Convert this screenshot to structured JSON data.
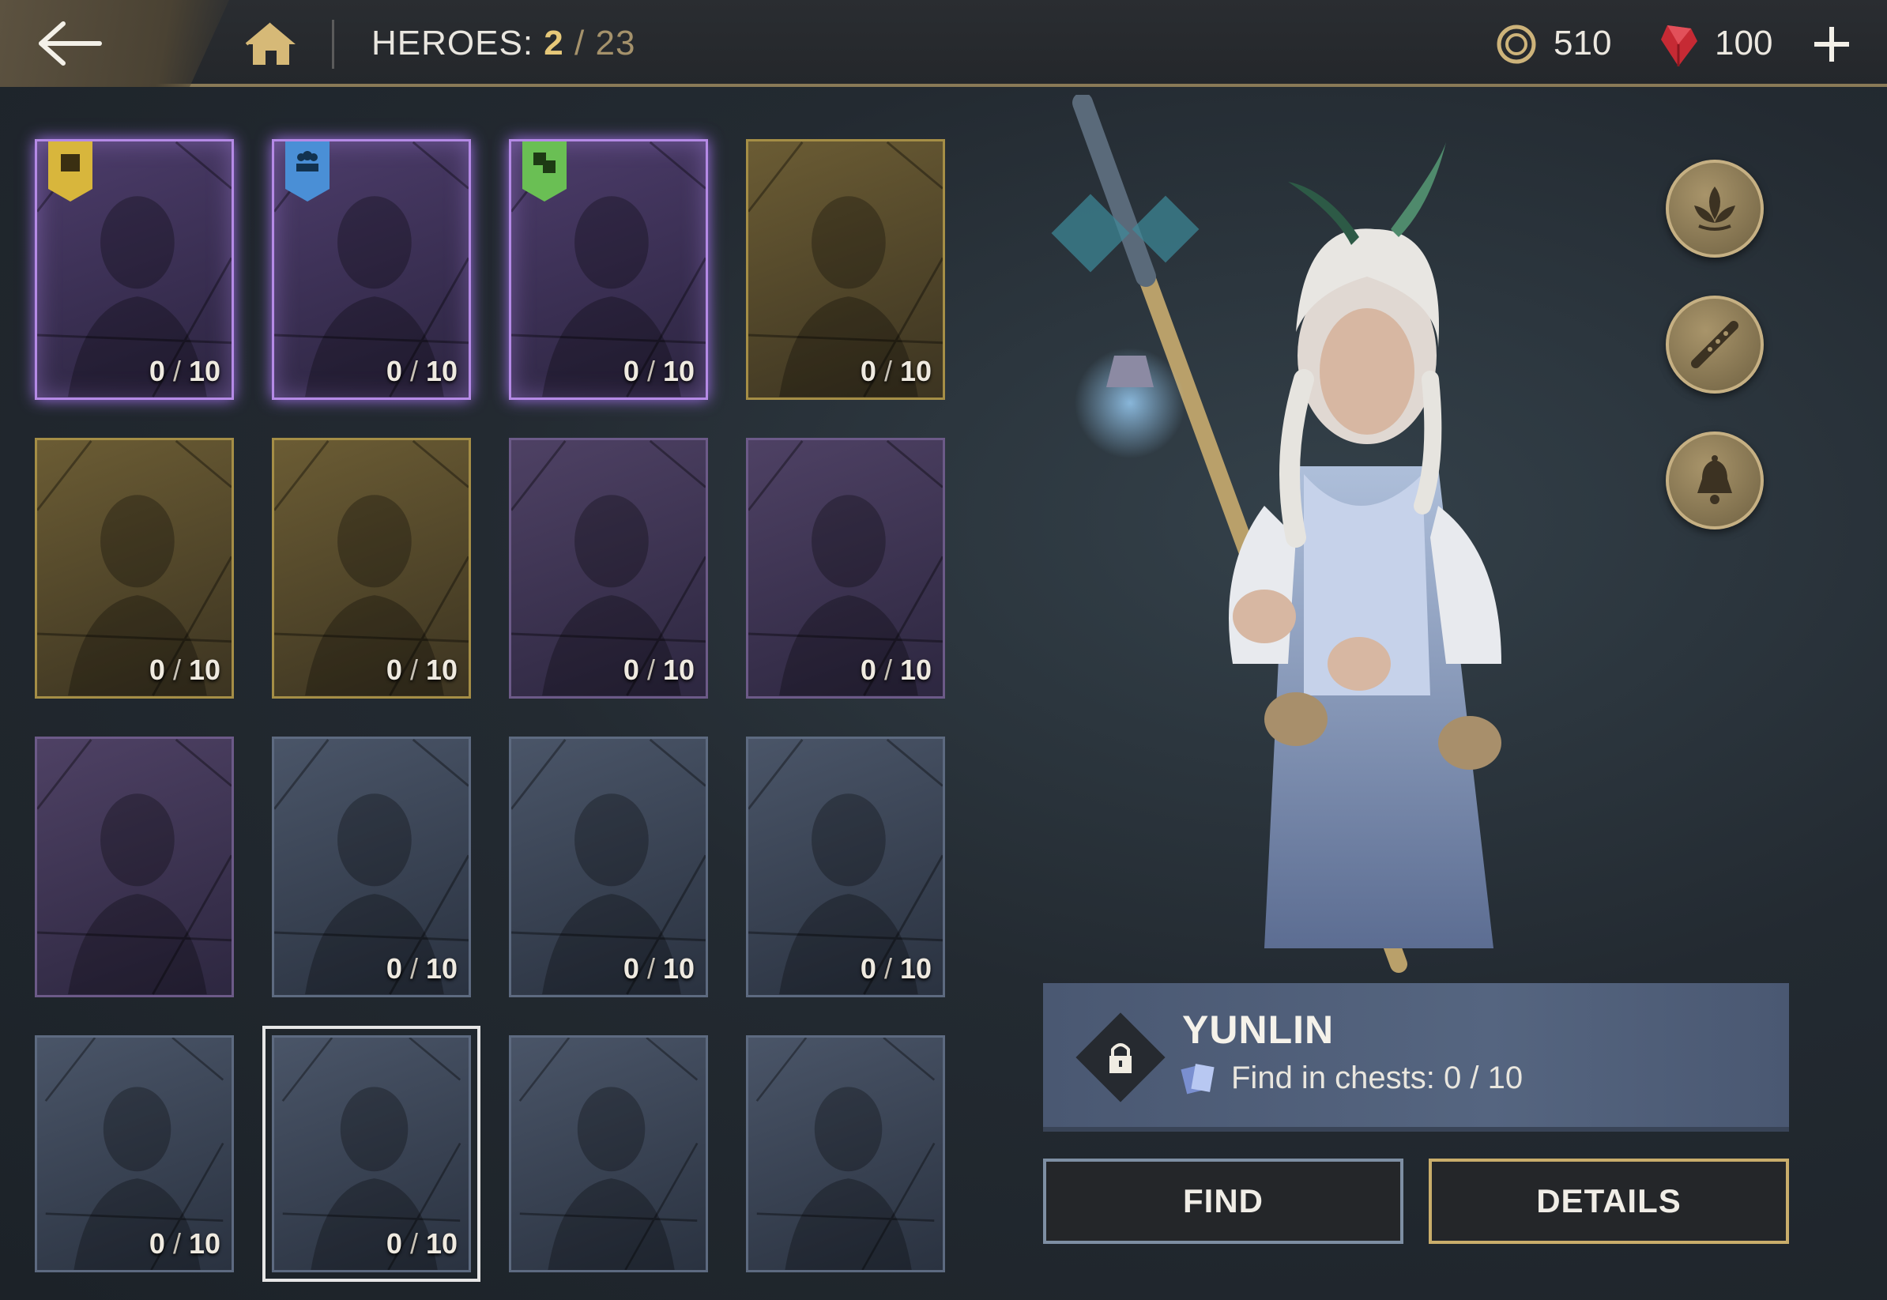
{
  "header": {
    "title_label": "HEROES:",
    "owned": "2",
    "separator": "/",
    "total": "23",
    "coins": "510",
    "gems": "100"
  },
  "icons": {
    "back": "back-arrow-icon",
    "home": "home-icon",
    "coin": "coin-icon",
    "gem": "gem-icon",
    "add": "plus-icon"
  },
  "colors": {
    "accent_gold": "#c9ad6b",
    "epic_purple": "#b58ae6",
    "owned_highlight": "#e6c879"
  },
  "cards": [
    {
      "count": "0",
      "max": "10",
      "rarity": "epic",
      "tag": "chest"
    },
    {
      "count": "0",
      "max": "10",
      "rarity": "epic",
      "tag": "group"
    },
    {
      "count": "0",
      "max": "10",
      "rarity": "epic",
      "tag": "dice"
    },
    {
      "count": "0",
      "max": "10",
      "rarity": "legend"
    },
    {
      "count": "0",
      "max": "10",
      "rarity": "legend"
    },
    {
      "count": "0",
      "max": "10",
      "rarity": "legend"
    },
    {
      "count": "0",
      "max": "10",
      "rarity": "purple"
    },
    {
      "count": "0",
      "max": "10",
      "rarity": "purple"
    },
    {
      "count": "",
      "max": "",
      "rarity": "purple"
    },
    {
      "count": "0",
      "max": "10",
      "rarity": "rare"
    },
    {
      "count": "0",
      "max": "10",
      "rarity": "rare"
    },
    {
      "count": "0",
      "max": "10",
      "rarity": "rare"
    },
    {
      "count": "0",
      "max": "10",
      "rarity": "rare"
    },
    {
      "count": "0",
      "max": "10",
      "rarity": "rare",
      "selected": true
    },
    {
      "count": "",
      "max": "",
      "rarity": "rare"
    },
    {
      "count": "",
      "max": "",
      "rarity": "rare"
    }
  ],
  "hero": {
    "name": "YUNLIN",
    "find_label": "Find in chests: 0 / 10"
  },
  "buttons": {
    "find": "FIND",
    "details": "DETAILS"
  }
}
